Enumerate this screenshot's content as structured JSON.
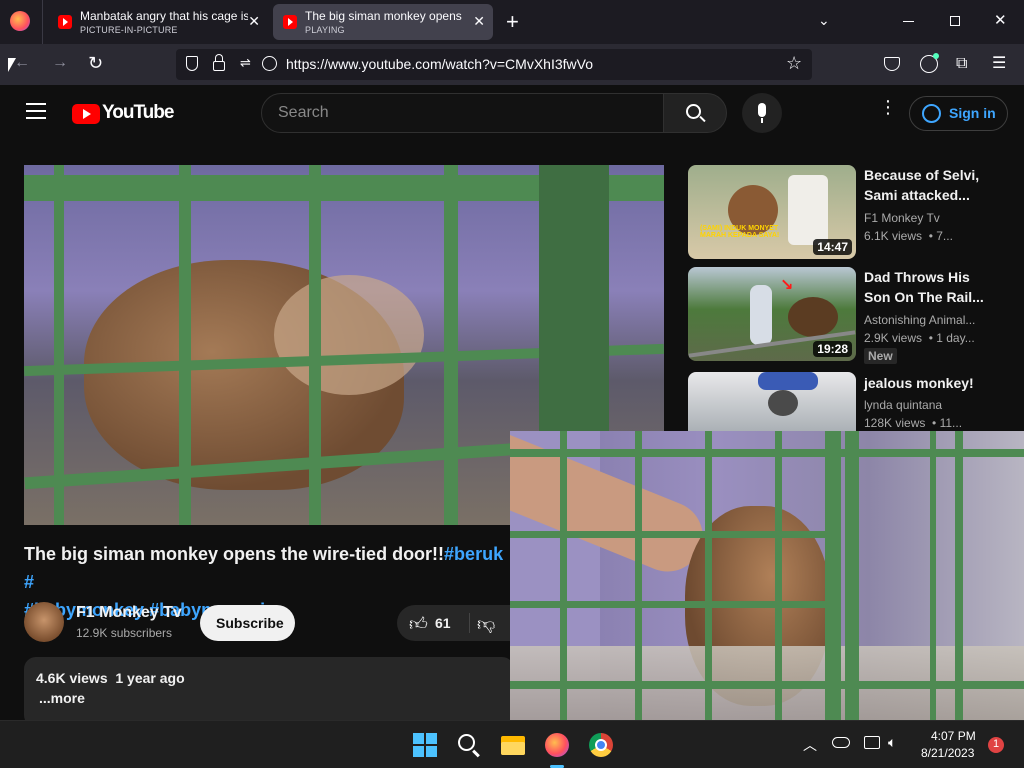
{
  "tabs": [
    {
      "title": "Manbatak angry that his cage is",
      "subtitle": "PICTURE-IN-PICTURE"
    },
    {
      "title": "The big siman monkey opens th",
      "subtitle": "PLAYING"
    }
  ],
  "url": "https://www.youtube.com/watch?v=CMvXhI3fwVo",
  "youtube": {
    "logo_text": "YouTube",
    "search_placeholder": "Search",
    "sign_in": "Sign in",
    "video_title_line1": "The big siman monkey opens the wire-tied door!!",
    "video_title_tag1": "#beruk",
    "video_title_tag1b": "#",
    "video_title_tag2": "#babymonkey",
    "video_title_tag3": "#babymonpai",
    "channel_name": "F1 Monkey Tv",
    "subscribers": "12.9K subscribers",
    "subscribe_label": "Subscribe",
    "likes": "61",
    "views_line": "4.6K views  1 year ago",
    "more_label": "...more"
  },
  "recommendations": [
    {
      "title_line1": "Because of Selvi,",
      "title_line2": "Sami attacked...",
      "channel": "F1 Monkey Tv",
      "meta": "6.1K views  • 7...",
      "duration": "14:47",
      "thumb_text1": "(SAMI) INDUK MONYET",
      "thumb_text2": "MARAH KEPADA SAYA!"
    },
    {
      "title_line1": "Dad Throws His",
      "title_line2": "Son On The Rail...",
      "channel": "Astonishing Animal...",
      "meta": "2.9K views  • 1 day...",
      "duration": "19:28",
      "badge": "New"
    },
    {
      "title_line1": "jealous monkey!",
      "channel": "lynda quintana",
      "meta": "128K views  • 11..."
    }
  ],
  "taskbar": {
    "time": "4:07 PM",
    "date": "8/21/2023",
    "notification_count": "1"
  }
}
